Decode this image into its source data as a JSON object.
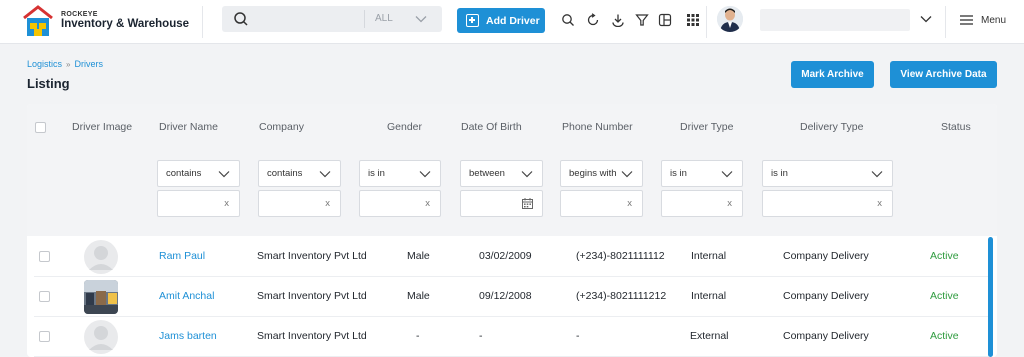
{
  "brand": {
    "small": "ROCKEYE",
    "name": "Inventory & Warehouse"
  },
  "search": {
    "filter": "ALL"
  },
  "header": {
    "add_driver": "Add Driver",
    "menu": "Menu"
  },
  "breadcrumb": {
    "first": "Logistics",
    "second": "Drivers"
  },
  "page": {
    "title": "Listing"
  },
  "actions": {
    "mark_archive": "Mark Archive",
    "view_archive": "View Archive Data"
  },
  "columns": [
    "Driver Image",
    "Driver Name",
    "Company",
    "Gender",
    "Date Of Birth",
    "Phone Number",
    "Driver Type",
    "Delivery Type",
    "Status"
  ],
  "filters": {
    "name": "contains",
    "company": "contains",
    "gender": "is in",
    "dob": "between",
    "phone": "begins with",
    "driver_type": "is in",
    "delivery_type": "is in",
    "clear": "x"
  },
  "rows": [
    {
      "name": "Ram Paul",
      "company": "Smart Inventory Pvt Ltd",
      "gender": "Male",
      "dob": "03/02/2009",
      "phone": "(+234)-8021111112",
      "driver_type": "Internal",
      "delivery_type": "Company Delivery",
      "status": "Active"
    },
    {
      "name": "Amit Anchal",
      "company": "Smart Inventory Pvt Ltd",
      "gender": "Male",
      "dob": "09/12/2008",
      "phone": "(+234)-8021111212",
      "driver_type": "Internal",
      "delivery_type": "Company Delivery",
      "status": "Active"
    },
    {
      "name": "Jams barten",
      "company": "Smart Inventory Pvt Ltd",
      "gender": "-",
      "dob": "-",
      "phone": "-",
      "driver_type": "External",
      "delivery_type": "Company Delivery",
      "status": "Active"
    }
  ],
  "colors": {
    "accent": "#1e90d6",
    "active": "#2e9b3e"
  }
}
